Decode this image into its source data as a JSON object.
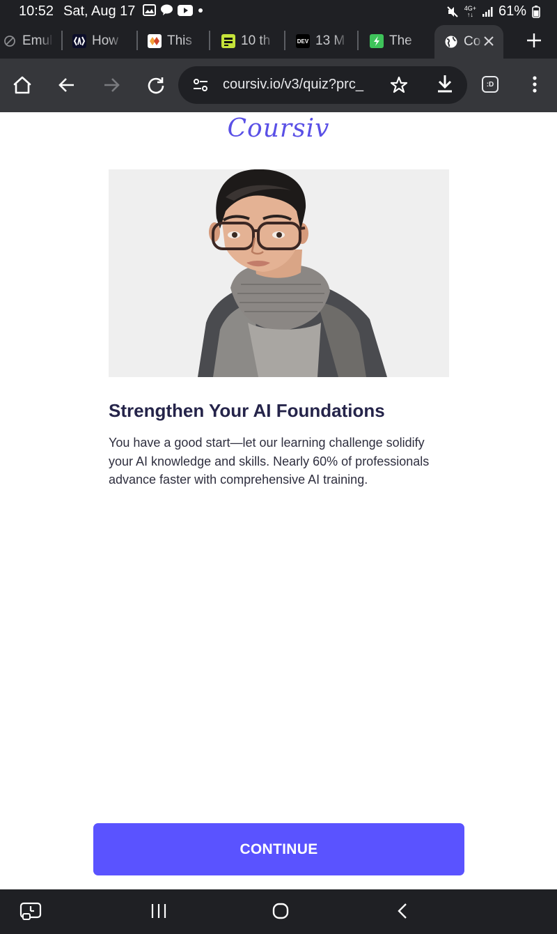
{
  "status_bar": {
    "time": "10:52",
    "date": "Sat, Aug 17",
    "network_top": "4G+",
    "network_bottom": "↑↓",
    "battery": "61%",
    "notification_icons": [
      "image-icon",
      "chat-bubble-icon",
      "youtube-icon",
      "dot-icon"
    ],
    "system_icons": [
      "mute-icon",
      "network-4g-icon",
      "signal-icon",
      "battery-icon"
    ]
  },
  "tabs": [
    {
      "title": "Emul",
      "favicon": "blocked-icon"
    },
    {
      "title": "How",
      "favicon": "brackets-logo-icon"
    },
    {
      "title": "This",
      "favicon": "colorful-logo-icon"
    },
    {
      "title": "10 th",
      "favicon": "zdnet-logo-icon"
    },
    {
      "title": "13 M",
      "favicon": "dev-logo-icon"
    },
    {
      "title": "The",
      "favicon": "green-logo-icon"
    }
  ],
  "active_tab": {
    "title": "Co",
    "favicon": "globe-icon"
  },
  "dev_favicon_text": "DEV",
  "toolbar": {
    "url": "coursiv.io/v3/quiz?prc_",
    "extension_label": ":D"
  },
  "page": {
    "brand": "Coursiv",
    "headline": "Strengthen Your AI Foundations",
    "body": "You have a good start—let our learning challenge solidify your AI knowledge and skills. Nearly 60% of professionals advance faster with comprehensive AI training.",
    "cta": "CONTINUE"
  },
  "colors": {
    "system_bg": "#1f2024",
    "toolbar_bg": "#36373b",
    "brand": "#5a50e6",
    "button": "#5a53ff",
    "heading": "#25244a",
    "hero_bg": "#efefef"
  }
}
